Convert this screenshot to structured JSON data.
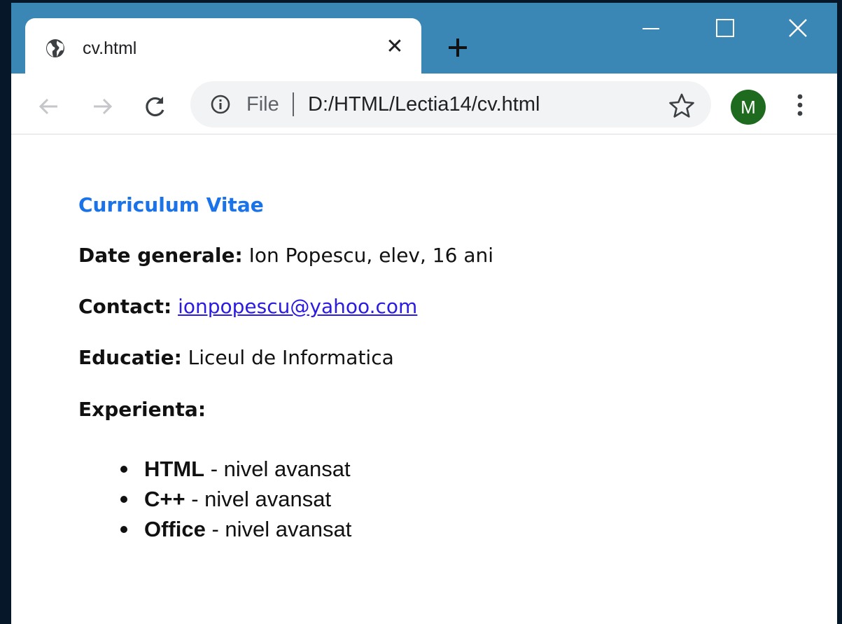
{
  "browser": {
    "tab": {
      "title": "cv.html",
      "close_glyph": "✕",
      "icon": "globe-icon"
    },
    "new_tab_icon": "plus-icon",
    "window_controls": [
      "minimize-icon",
      "maximize-icon",
      "close-icon"
    ],
    "toolbar": {
      "back_icon": "arrow-left-icon",
      "forward_icon": "arrow-right-icon",
      "reload_icon": "reload-icon",
      "info_icon": "info-icon",
      "scheme_label": "File",
      "url": "D:/HTML/Lectia14/cv.html",
      "bookmark_icon": "star-icon",
      "avatar_letter": "M",
      "menu_icon": "kebab-menu-icon"
    },
    "colors": {
      "titlebar": "#3a87b5",
      "avatar": "#1e6a1e",
      "heading": "#1a73e8",
      "link": "#2b1be0"
    }
  },
  "page": {
    "heading": "Curriculum Vitae",
    "general": {
      "label": "Date generale:",
      "value": " Ion Popescu, elev, 16 ani"
    },
    "contact": {
      "label": "Contact:",
      "email": "ionpopescu@yahoo.com"
    },
    "education": {
      "label": "Educatie:",
      "value": " Liceul de Informatica"
    },
    "experience": {
      "label": "Experienta:",
      "items": [
        {
          "name": "HTML",
          "level": " - nivel avansat"
        },
        {
          "name": "C++",
          "level": " - nivel avansat"
        },
        {
          "name": "Office",
          "level": " - nivel avansat"
        }
      ]
    }
  }
}
